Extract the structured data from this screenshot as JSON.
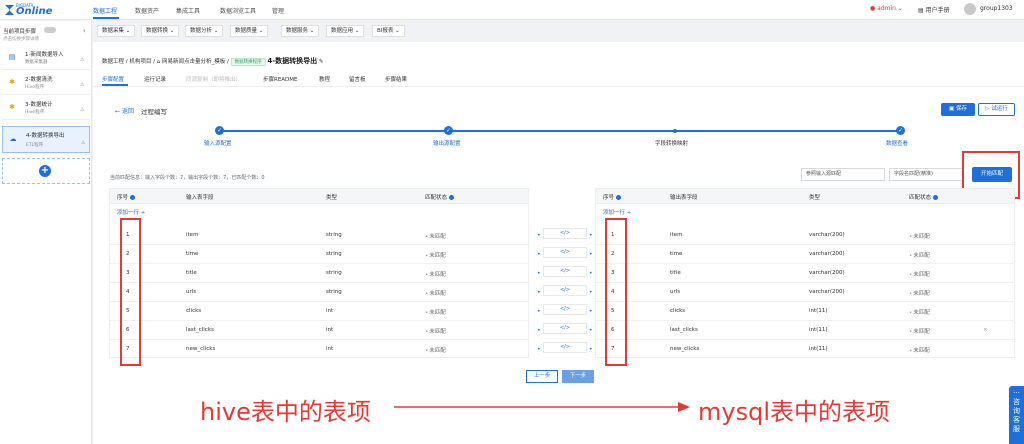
{
  "brand": {
    "small": "BIGDATA",
    "name": "Online"
  },
  "topnav": [
    "数据工程",
    "数据资产",
    "集成工具",
    "数据浏览工具",
    "管理"
  ],
  "topright": {
    "user": "admin",
    "manual": "用户手册",
    "group": "group1303"
  },
  "subnav": [
    "数据采集",
    "数据转换",
    "数据分析",
    "数据质量",
    "数据服务",
    "数据应用",
    "BI报表"
  ],
  "sidebar": {
    "title": "当前项目步骤",
    "subtitle": "点击切换步骤详情",
    "steps": [
      {
        "name": "1-新闻数据导入",
        "type": "数据采集器",
        "icon": "database-icon"
      },
      {
        "name": "2-数据清洗",
        "type": "Hive程序",
        "icon": "bee-icon"
      },
      {
        "name": "3-数据统计",
        "type": "Hive程序",
        "icon": "bee-icon"
      },
      {
        "name": "4-数据转换导出",
        "type": "ETL程序",
        "icon": "cloud-icon"
      }
    ]
  },
  "crumb": {
    "root": "数据工程",
    "project": "机构项目",
    "template": "网易新闻点击量分析_模板",
    "tag": "数据转换程序",
    "current": "4-数据转换导出"
  },
  "tabs": [
    "步骤配置",
    "运行记录",
    "同源复制（即将推出）",
    "步骤README",
    "教程",
    "留言板",
    "步骤结果"
  ],
  "process": {
    "back": "返回",
    "title": "过程编写",
    "save": "保存",
    "run": "试运行"
  },
  "progress": [
    "输入源配置",
    "输出源配置",
    "字段转换映射",
    "数据查看"
  ],
  "match": {
    "info": "当前匹配信息：输入字段个数：7，输出字段个数：7，已匹配个数：0",
    "select1": "参照输入源匹配",
    "select2": "字段名匹配(精准)",
    "button": "开始匹配"
  },
  "left_table": {
    "headers": [
      "序号",
      "输入表字段",
      "类型",
      "匹配状态"
    ],
    "add": "添加一行",
    "rows": [
      {
        "no": "1",
        "field": "item",
        "type": "string",
        "status": "未匹配"
      },
      {
        "no": "2",
        "field": "time",
        "type": "string",
        "status": "未匹配"
      },
      {
        "no": "3",
        "field": "title",
        "type": "string",
        "status": "未匹配"
      },
      {
        "no": "4",
        "field": "urls",
        "type": "string",
        "status": "未匹配"
      },
      {
        "no": "5",
        "field": "clicks",
        "type": "int",
        "status": "未匹配"
      },
      {
        "no": "6",
        "field": "last_clicks",
        "type": "int",
        "status": "未匹配"
      },
      {
        "no": "7",
        "field": "new_clicks",
        "type": "int",
        "status": "未匹配"
      }
    ]
  },
  "right_table": {
    "headers": [
      "序号",
      "输出表字段",
      "类型",
      "匹配状态"
    ],
    "add": "添加一行",
    "rows": [
      {
        "no": "1",
        "field": "item",
        "type": "varchar(200)",
        "status": "未匹配"
      },
      {
        "no": "2",
        "field": "time",
        "type": "varchar(200)",
        "status": "未匹配"
      },
      {
        "no": "3",
        "field": "title",
        "type": "varchar(200)",
        "status": "未匹配"
      },
      {
        "no": "4",
        "field": "urls",
        "type": "varchar(200)",
        "status": "未匹配"
      },
      {
        "no": "5",
        "field": "clicks",
        "type": "int(11)",
        "status": "未匹配"
      },
      {
        "no": "6",
        "field": "last_clicks",
        "type": "int(11)",
        "status": "未匹配"
      },
      {
        "no": "7",
        "field": "new_clicks",
        "type": "int(11)",
        "status": "未匹配"
      }
    ]
  },
  "link_symbol": "</>",
  "pager": {
    "prev": "上一步",
    "next": "下一步"
  },
  "annotation": {
    "left": "hive表中的表项",
    "right": "mysql表中的表项"
  },
  "float_service": "咨询客服",
  "colors": {
    "primary": "#1e6fd9",
    "annotation": "#e53935"
  }
}
